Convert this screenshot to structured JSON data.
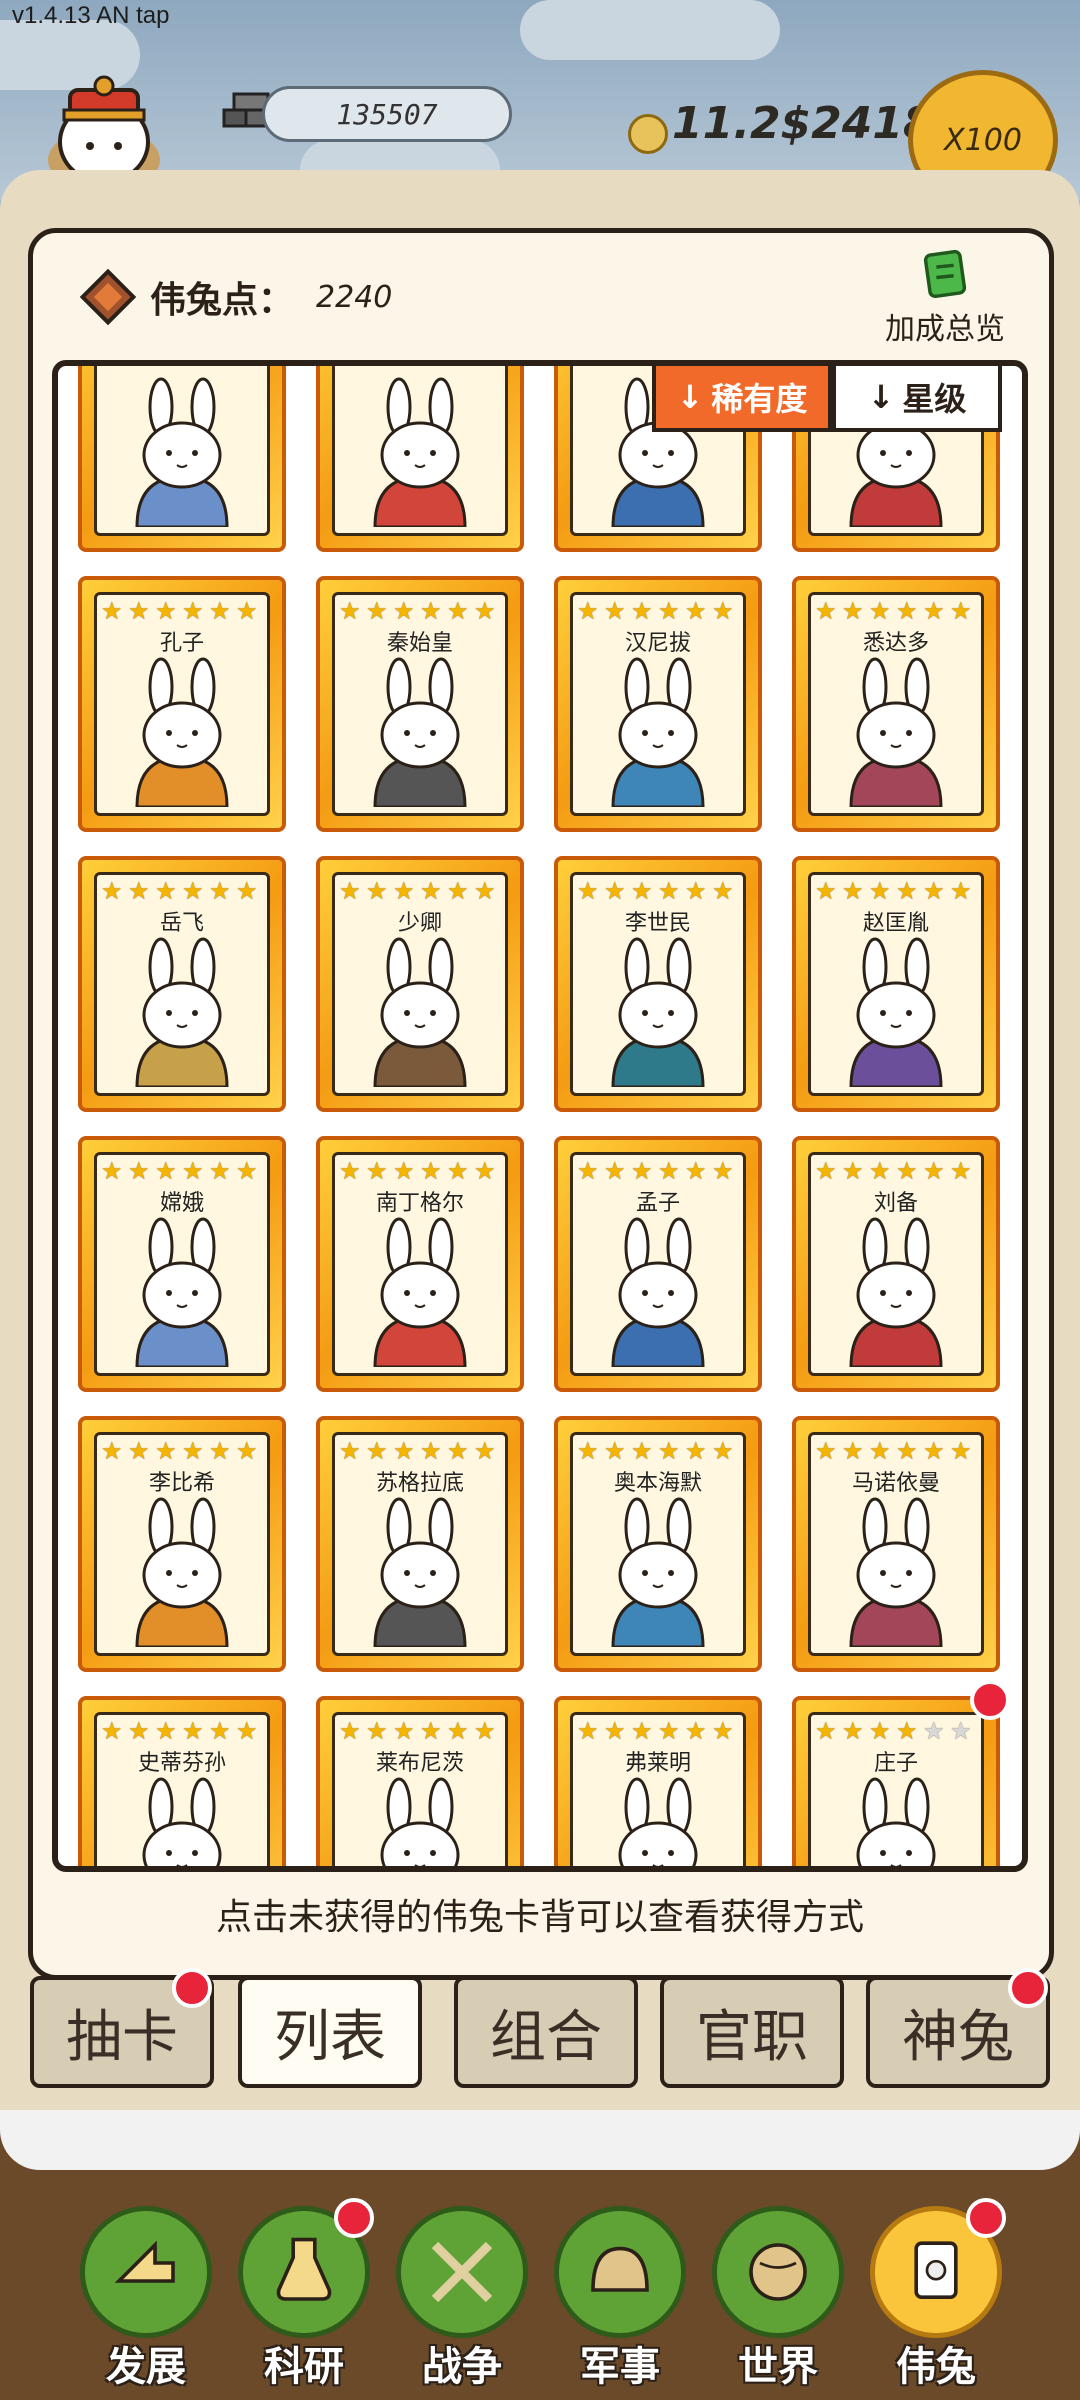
{
  "app": {
    "version": "v1.4.13 AN tap"
  },
  "header": {
    "resource_value": "135507",
    "coin_rate": "11.2$2418",
    "multiplier": "X100"
  },
  "panel": {
    "points_label": "伟兔点：",
    "points_value": "2240",
    "bonus_label": "加成总览",
    "sort_rarity": "稀有度",
    "sort_stars": "星级",
    "hint": "点击未获得的伟兔卡背可以查看获得方式"
  },
  "cards": [
    {
      "name": "",
      "stars": 0
    },
    {
      "name": "",
      "stars": 0
    },
    {
      "name": "",
      "stars": 0
    },
    {
      "name": "",
      "stars": 0
    },
    {
      "name": "孔子",
      "stars": 6
    },
    {
      "name": "秦始皇",
      "stars": 6
    },
    {
      "name": "汉尼拔",
      "stars": 6
    },
    {
      "name": "悉达多",
      "stars": 6
    },
    {
      "name": "岳飞",
      "stars": 6
    },
    {
      "name": "少卿",
      "stars": 6
    },
    {
      "name": "李世民",
      "stars": 6
    },
    {
      "name": "赵匡胤",
      "stars": 6
    },
    {
      "name": "嫦娥",
      "stars": 6
    },
    {
      "name": "南丁格尔",
      "stars": 6
    },
    {
      "name": "孟子",
      "stars": 6
    },
    {
      "name": "刘备",
      "stars": 6
    },
    {
      "name": "李比希",
      "stars": 6
    },
    {
      "name": "苏格拉底",
      "stars": 6
    },
    {
      "name": "奥本海默",
      "stars": 6
    },
    {
      "name": "马诺依曼",
      "stars": 6
    },
    {
      "name": "史蒂芬孙",
      "stars": 6
    },
    {
      "name": "莱布尼茨",
      "stars": 6
    },
    {
      "name": "弗莱明",
      "stars": 6
    },
    {
      "name": "庄子",
      "stars": 4
    }
  ],
  "subtabs": [
    {
      "label": "抽卡",
      "active": false,
      "badge": true
    },
    {
      "label": "列表",
      "active": true,
      "badge": false
    },
    {
      "label": "组合",
      "active": false,
      "badge": false
    },
    {
      "label": "官职",
      "active": false,
      "badge": false
    },
    {
      "label": "神兔",
      "active": false,
      "badge": true
    }
  ],
  "nav": [
    {
      "label": "发展",
      "active": false,
      "badge": false,
      "icon": "arrow-up-icon"
    },
    {
      "label": "科研",
      "active": false,
      "badge": true,
      "icon": "flask-icon"
    },
    {
      "label": "战争",
      "active": false,
      "badge": false,
      "icon": "crossed-swords-icon"
    },
    {
      "label": "军事",
      "active": false,
      "badge": false,
      "icon": "helmet-icon"
    },
    {
      "label": "世界",
      "active": false,
      "badge": false,
      "icon": "globe-icon"
    },
    {
      "label": "伟兔",
      "active": true,
      "badge": true,
      "icon": "card-icon"
    }
  ],
  "colors": {
    "card_gold": "#f49b12",
    "accent_orange": "#f26a2a",
    "badge_red": "#e8243a",
    "nav_green": "#5fa336",
    "nav_active": "#fbc53b"
  }
}
